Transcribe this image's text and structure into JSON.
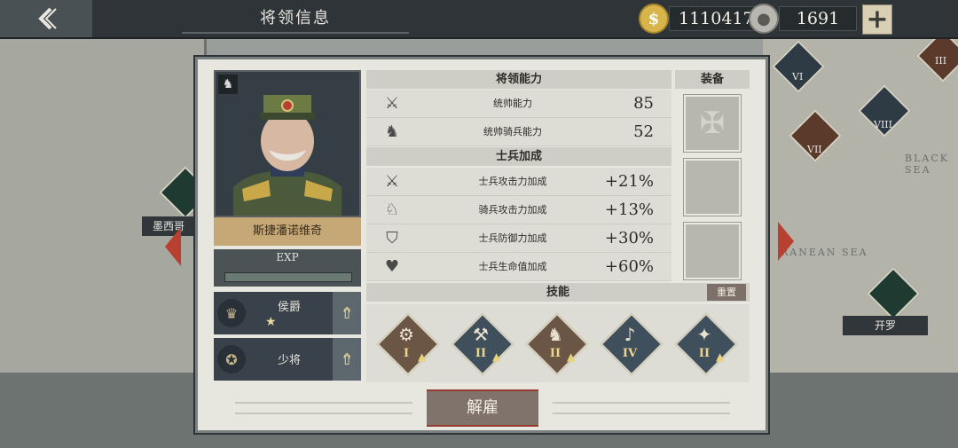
{
  "header": {
    "title": "将领信息",
    "gold_value": "1110417",
    "medal_value": "1691",
    "add_label": "+"
  },
  "map": {
    "city_left": "墨西哥",
    "city_right": "开罗",
    "sea_text_1": "BLACK SEA",
    "sea_text_2": "RANEAN SEA",
    "markers": [
      "VI",
      "VII",
      "VIII",
      "III"
    ]
  },
  "general": {
    "name": "斯捷潘诺维奇",
    "exp_label": "EXP",
    "exp_fraction": 0.0,
    "title_rank": "侯爵",
    "title_stars": "★",
    "military_rank": "少将",
    "upgrade_icon": "⇮"
  },
  "abilities": {
    "header": "将领能力",
    "rows": [
      {
        "icon": "crossed-swords-icon",
        "label": "统帅能力",
        "value": "85"
      },
      {
        "icon": "horse-head-icon",
        "label": "统帅骑兵能力",
        "value": "52"
      }
    ]
  },
  "soldier_bonus": {
    "header": "士兵加成",
    "rows": [
      {
        "icon": "attack-plus-icon",
        "label": "士兵攻击力加成",
        "value": "+21%"
      },
      {
        "icon": "cavalry-plus-icon",
        "label": "骑兵攻击力加成",
        "value": "+13%"
      },
      {
        "icon": "shield-plus-icon",
        "label": "士兵防御力加成",
        "value": "+30%"
      },
      {
        "icon": "heart-plus-icon",
        "label": "士兵生命值加成",
        "value": "+60%"
      }
    ]
  },
  "equipment": {
    "header": "装备",
    "slots": [
      "order-star-icon",
      "empty",
      "empty"
    ]
  },
  "skills": {
    "header": "技能",
    "reset_label": "重置",
    "items": [
      {
        "icon": "artillery-icon",
        "level": "I",
        "color": "#6b5544"
      },
      {
        "icon": "pickaxe-icon",
        "level": "II",
        "color": "#3f4f5c"
      },
      {
        "icon": "cavalry-charge-icon",
        "level": "II",
        "color": "#6b5544"
      },
      {
        "icon": "bugle-icon",
        "level": "IV",
        "color": "#3f4f5c"
      },
      {
        "icon": "eagle-icon",
        "level": "II",
        "color": "#3f4f5c"
      }
    ]
  },
  "actions": {
    "dismiss_label": "解雇"
  },
  "colors": {
    "panel_bg": "#e7e6df",
    "accent_red": "#b84030",
    "name_plate": "#c6a877"
  }
}
